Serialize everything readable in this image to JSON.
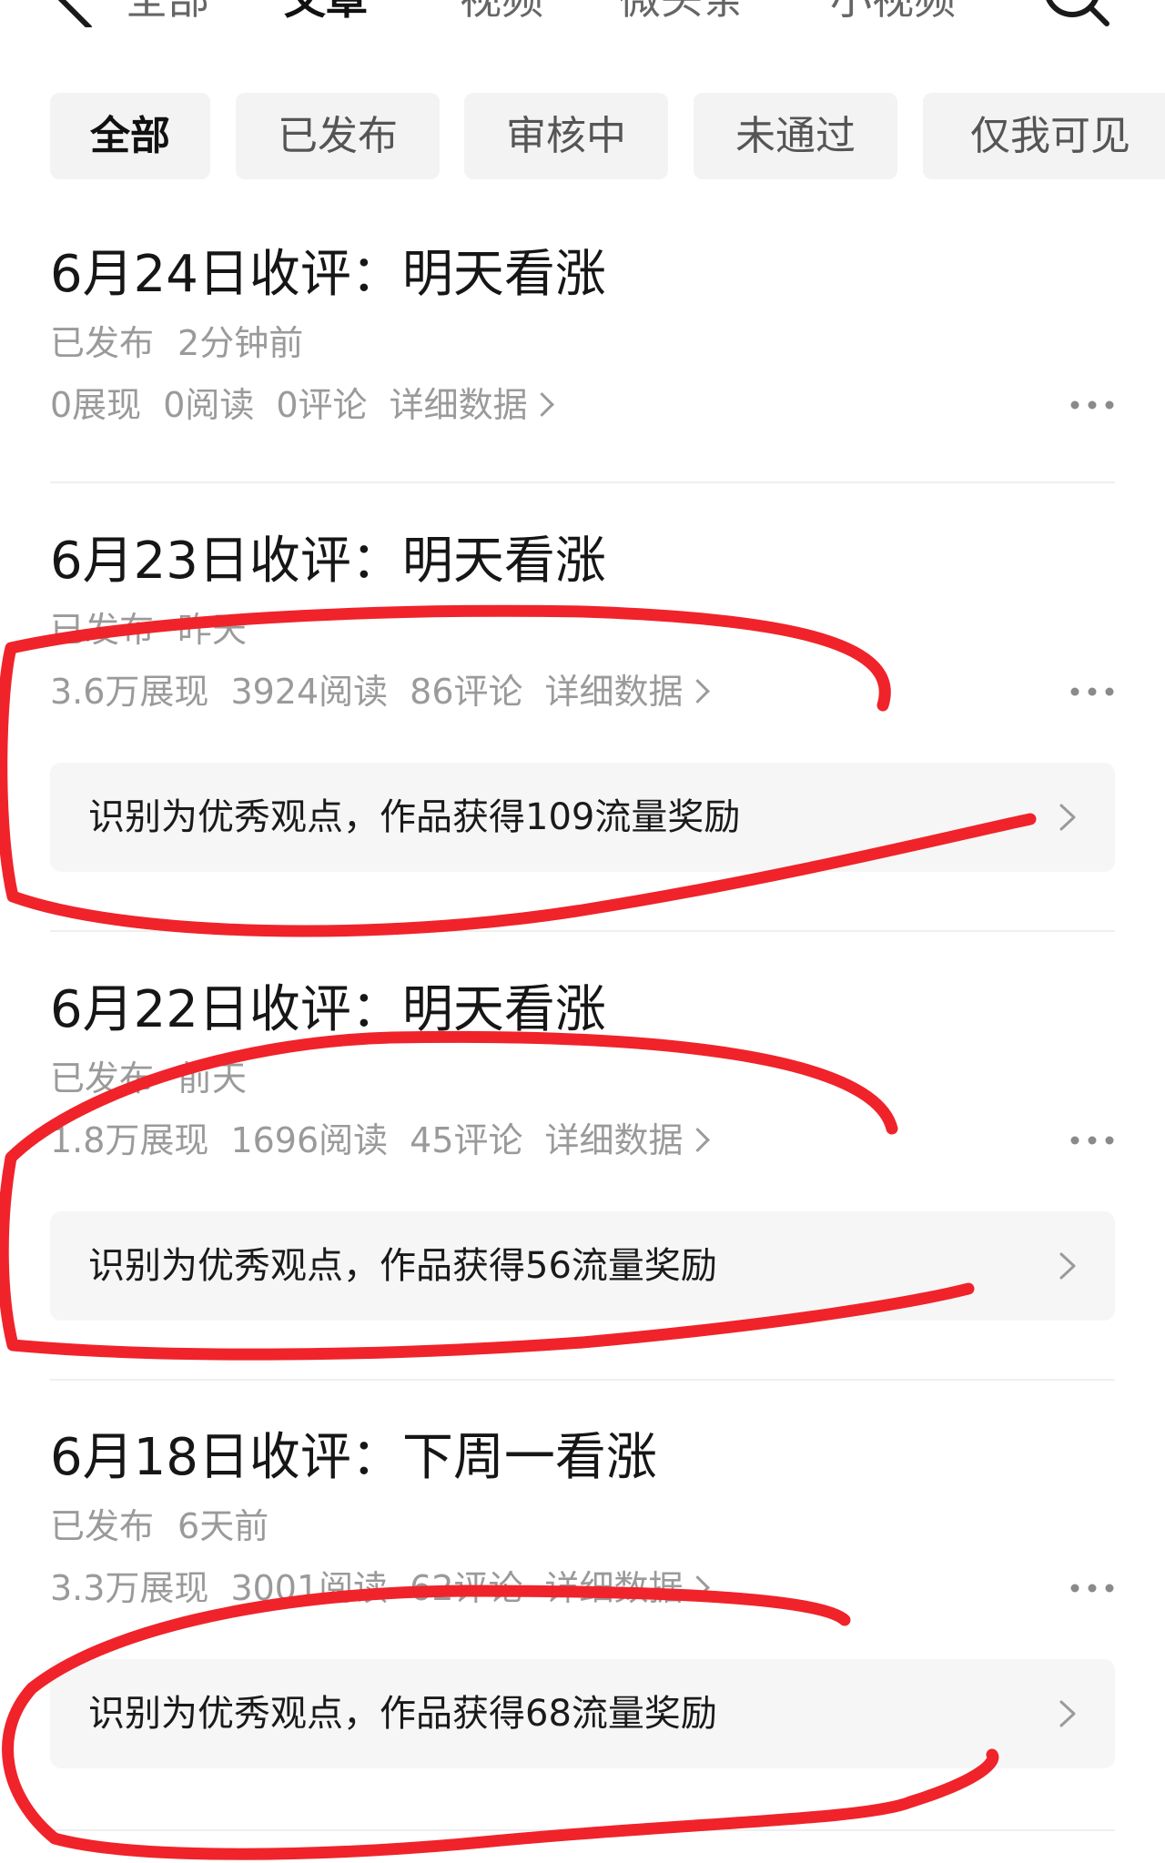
{
  "nav": {
    "tabs": [
      "全部",
      "文章",
      "视频",
      "微头条",
      "小视频"
    ],
    "active_tab": "文章"
  },
  "filters": {
    "chips": [
      "全部",
      "已发布",
      "审核中",
      "未通过",
      "仅我可见"
    ],
    "active": "全部"
  },
  "articles": [
    {
      "title": "6月24日收评：明天看涨",
      "status": "已发布",
      "time": "2分钟前",
      "impressions": "0展现",
      "reads": "0阅读",
      "comments": "0评论",
      "detail_label": "详细数据",
      "reward": ""
    },
    {
      "title": "6月23日收评：明天看涨",
      "status": "已发布",
      "time": "昨天",
      "impressions": "3.6万展现",
      "reads": "3924阅读",
      "comments": "86评论",
      "detail_label": "详细数据",
      "reward": "识别为优秀观点，作品获得109流量奖励"
    },
    {
      "title": "6月22日收评：明天看涨",
      "status": "已发布",
      "time": "前天",
      "impressions": "1.8万展现",
      "reads": "1696阅读",
      "comments": "45评论",
      "detail_label": "详细数据",
      "reward": "识别为优秀观点，作品获得56流量奖励"
    },
    {
      "title": "6月18日收评：下周一看涨",
      "status": "已发布",
      "time": "6天前",
      "impressions": "3.3万展现",
      "reads": "3001阅读",
      "comments": "62评论",
      "detail_label": "详细数据",
      "reward": "识别为优秀观点，作品获得68流量奖励"
    }
  ],
  "colors": {
    "annotation": "#f0232a",
    "chip_bg": "#f3f3f3",
    "reward_bg": "#f6f6f6",
    "muted_text": "#9a9a9a"
  }
}
